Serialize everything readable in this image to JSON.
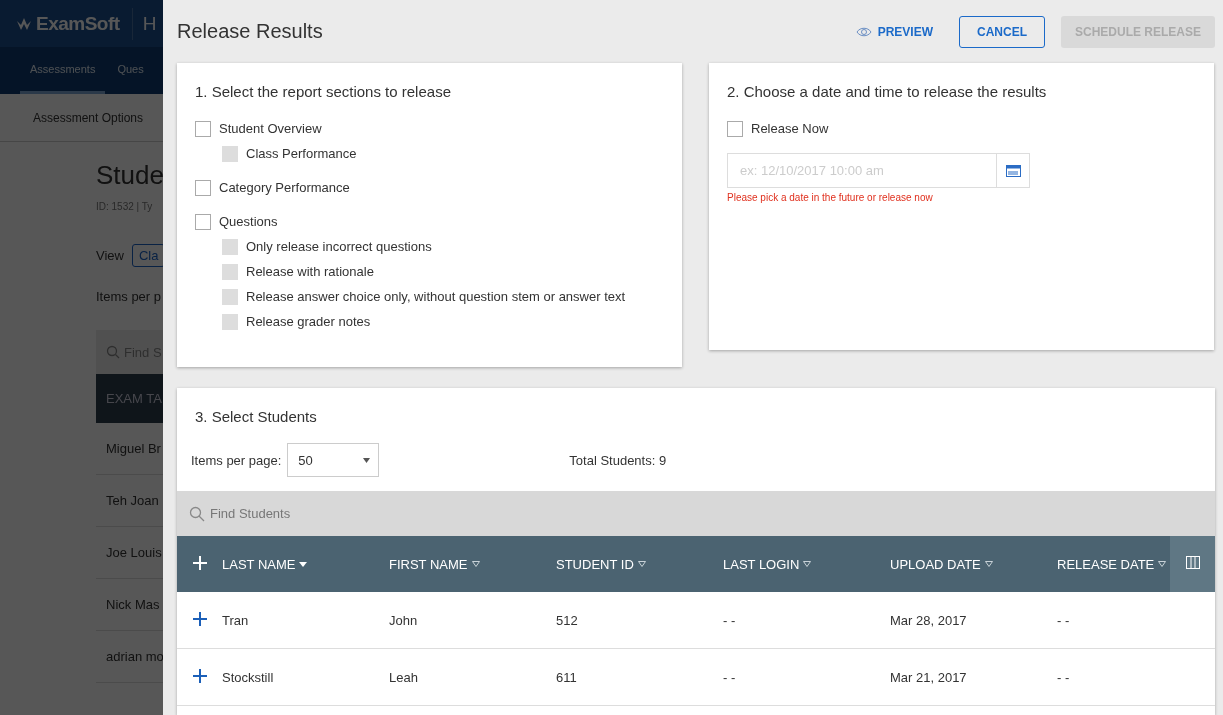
{
  "background": {
    "logo": "ExamSoft",
    "header_link": "H",
    "nav": [
      {
        "label": "Assessments",
        "selected": true
      },
      {
        "label": "Ques",
        "selected": false
      }
    ],
    "subnav": "Assessment Options",
    "title": "Stude",
    "meta": "ID: 1532 | Ty",
    "view_label": "View",
    "view_button": "Cla",
    "items_label": "Items per p",
    "search_placeholder": "Find S",
    "table_header": "EXAM TA",
    "rows": [
      "Miguel Br",
      "Teh Joan",
      "Joe Louis",
      "Nick Mas",
      "adrian mo"
    ]
  },
  "modal": {
    "title": "Release Results",
    "preview": "PREVIEW",
    "cancel": "CANCEL",
    "schedule": {
      "label": "SCHEDULE RELEASE",
      "disabled": true
    }
  },
  "sections": {
    "heading": "1. Select the report sections to release",
    "items": [
      {
        "label": "Student Overview",
        "checked": false,
        "disabled": false,
        "children": [
          {
            "label": "Class Performance",
            "checked": false,
            "disabled": true
          }
        ]
      },
      {
        "label": "Category Performance",
        "checked": false,
        "disabled": false
      },
      {
        "label": "Questions",
        "checked": false,
        "disabled": false,
        "children": [
          {
            "label": "Only release incorrect questions",
            "checked": false,
            "disabled": true
          },
          {
            "label": "Release with rationale",
            "checked": false,
            "disabled": true
          },
          {
            "label": "Release answer choice only, without question stem or answer text",
            "checked": false,
            "disabled": true
          },
          {
            "label": "Release grader notes",
            "checked": false,
            "disabled": true
          }
        ]
      }
    ]
  },
  "release": {
    "heading": "2. Choose a date and time to release the results",
    "release_now": {
      "label": "Release Now",
      "checked": false
    },
    "date_field": {
      "placeholder": "ex: 12/10/2017 10:00 am"
    },
    "error": "Please pick a date in the future or release now"
  },
  "students": {
    "heading": "3. Select Students",
    "items_per_page": {
      "label": "Items per page:",
      "value": "50"
    },
    "total": "Total Students: 9",
    "search": {
      "placeholder": "Find Students"
    },
    "columns": [
      {
        "label": "LAST NAME",
        "sorted": true
      },
      {
        "label": "FIRST NAME",
        "sorted": false
      },
      {
        "label": "STUDENT ID",
        "sorted": false
      },
      {
        "label": "LAST LOGIN",
        "sorted": false
      },
      {
        "label": "UPLOAD DATE",
        "sorted": false
      },
      {
        "label": "RELEASE DATE",
        "sorted": false
      }
    ],
    "rows": [
      {
        "cells": [
          "Tran",
          "John",
          "512",
          "- -",
          "Mar 28, 2017",
          "- -"
        ]
      },
      {
        "cells": [
          "Stockstill",
          "Leah",
          "611",
          "- -",
          "Mar 21, 2017",
          "- -"
        ]
      }
    ]
  }
}
